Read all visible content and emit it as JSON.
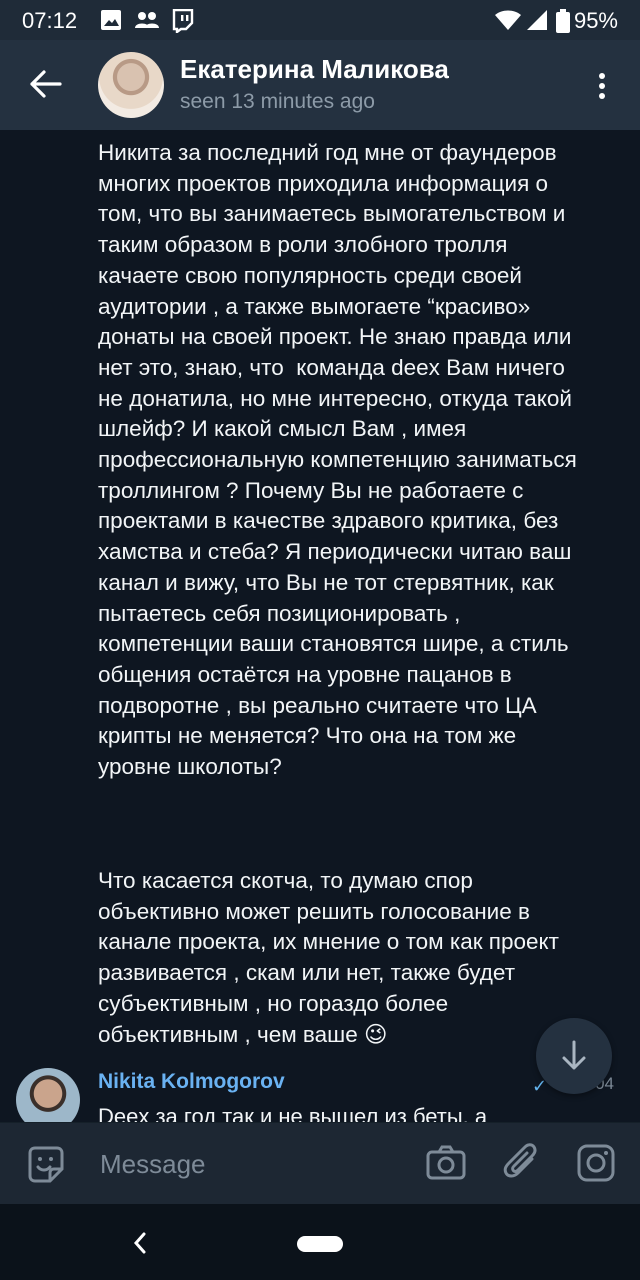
{
  "status_bar": {
    "time": "07:12",
    "battery": "95%",
    "icons": [
      "image-icon",
      "people-icon",
      "twitch-icon",
      "wifi-icon",
      "signal-icon",
      "battery-icon"
    ]
  },
  "header": {
    "name": "Екатерина Маликова",
    "status": "seen 13 minutes ago"
  },
  "messages": [
    {
      "text": "Никита за последний год мне от фаундеров многих проектов приходила информация о том, что вы занимаетесь вымогательством и таким образом в роли злобного тролля качаете свою популярность среди своей аудитории , а также вымогаете “красиво» донаты на своей проект. Не знаю правда или нет это, знаю, что  команда deex Вам ничего не донатила, но мне интересно, откуда такой шлейф? И какой смысл Вам , имея профессиональную компетенцию заниматься троллингом ? Почему Вы не работаете с проектами в качестве здравого критика, без хамства и стеба? Я периодически читаю ваш канал и вижу, что Вы не тот стервятник, как пытаетесь себя позиционировать , компетенции ваши становятся шире, а стиль общения остаётся на уровне пацанов в подворотне , вы реально считаете что ЦА крипты не меняется? Что она на том же уровне школоты?"
    },
    {
      "text": "Что касается скотча, то думаю спор объективно может решить голосование в канале проекта, их мнение о том как проект развивается , скам или нет, также будет субъективным , но гораздо более объективным , чем ваше 😉"
    }
  ],
  "reply": {
    "sender": "Nikita Kolmogorov",
    "time": "04",
    "preview": "Deex за год так и не вышел из беты, а"
  },
  "input": {
    "placeholder": "Message"
  },
  "colors": {
    "header_bg": "#243140",
    "chat_bg": "#0e1621",
    "accent": "#6ab2f2"
  }
}
